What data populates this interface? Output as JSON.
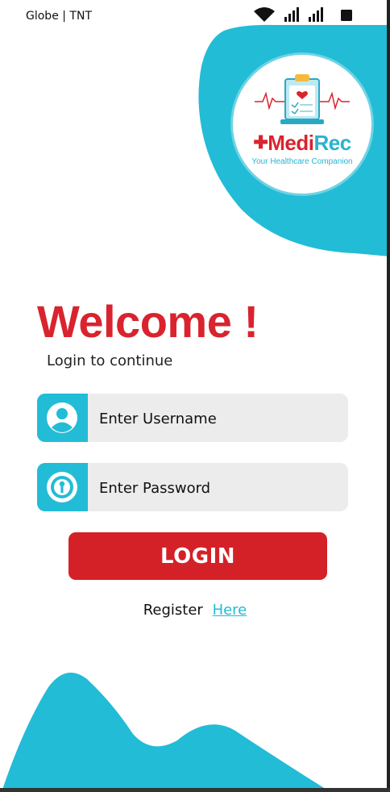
{
  "status_bar": {
    "carrier": "Globe | TNT"
  },
  "logo": {
    "brand_cross": "✚",
    "brand_part1": "Medi",
    "brand_part2": "Rec",
    "tagline": "Your Healthcare Companion"
  },
  "login": {
    "title": "Welcome !",
    "subtitle": "Login to continue",
    "username_placeholder": "Enter Username",
    "password_placeholder": "Enter Password",
    "button_label": "LOGIN",
    "register_text": "Register",
    "register_link": "Here"
  },
  "icons": {
    "username": "user-circle-icon",
    "password": "keyhole-icon"
  },
  "colors": {
    "accent_teal": "#22bcd6",
    "brand_red": "#d9232e",
    "button_red": "#d42128",
    "field_bg": "#ececec"
  }
}
